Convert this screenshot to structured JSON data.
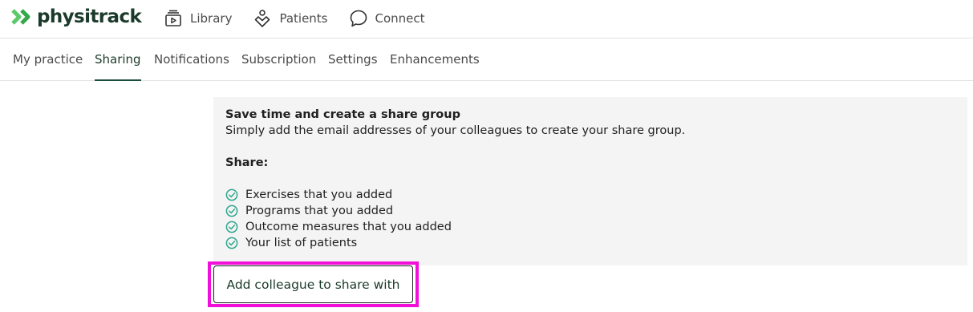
{
  "brand": {
    "name": "physitrack",
    "accent": "#1b4d3e",
    "mark_color": "#5cc96a"
  },
  "main_nav": [
    {
      "label": "Library",
      "icon": "library-icon"
    },
    {
      "label": "Patients",
      "icon": "patients-icon"
    },
    {
      "label": "Connect",
      "icon": "chat-bubble-icon"
    }
  ],
  "tabs": [
    {
      "label": "My practice",
      "active": false
    },
    {
      "label": "Sharing",
      "active": true
    },
    {
      "label": "Notifications",
      "active": false
    },
    {
      "label": "Subscription",
      "active": false
    },
    {
      "label": "Settings",
      "active": false
    },
    {
      "label": "Enhancements",
      "active": false
    }
  ],
  "card": {
    "title": "Save time and create a share group",
    "subtitle": "Simply add the email addresses of your colleagues to create your share group.",
    "share_label": "Share:",
    "benefits": [
      "Exercises that you added",
      "Programs that you added",
      "Outcome measures that you added",
      "Your list of patients"
    ],
    "check_color": "#2fa58f"
  },
  "add_button": {
    "label": "Add colleague to share with"
  },
  "highlight_color": "#f20fd9"
}
